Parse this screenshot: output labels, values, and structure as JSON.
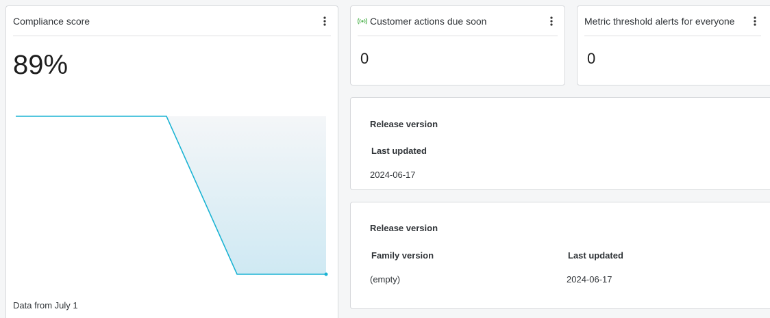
{
  "compliance": {
    "title": "Compliance score",
    "value": "89%",
    "footer": "Data from July 1",
    "line_color": "#1ab3d3"
  },
  "chart_data": {
    "type": "area",
    "x": [
      0,
      1,
      2,
      3,
      4,
      5
    ],
    "values": [
      96,
      96,
      96,
      85,
      85,
      85
    ],
    "series": [
      {
        "values": [
          96,
          96,
          96,
          85,
          85,
          85
        ]
      }
    ],
    "ylim": [
      84,
      97
    ],
    "grid": false,
    "title": "",
    "xlabel": "",
    "ylabel": ""
  },
  "customer_actions": {
    "title": "Customer actions due soon",
    "value": "0",
    "icon": "live-signal-icon",
    "icon_color": "#5cb85c"
  },
  "metric_alerts": {
    "title": "Metric threshold alerts for everyone",
    "value": "0"
  },
  "release1": {
    "heading": "Release version",
    "last_updated_label": "Last updated",
    "last_updated_value": "2024-06-17"
  },
  "release2": {
    "heading": "Release version",
    "family_label": "Family version",
    "family_value": "(empty)",
    "last_updated_label": "Last updated",
    "last_updated_value": "2024-06-17"
  }
}
